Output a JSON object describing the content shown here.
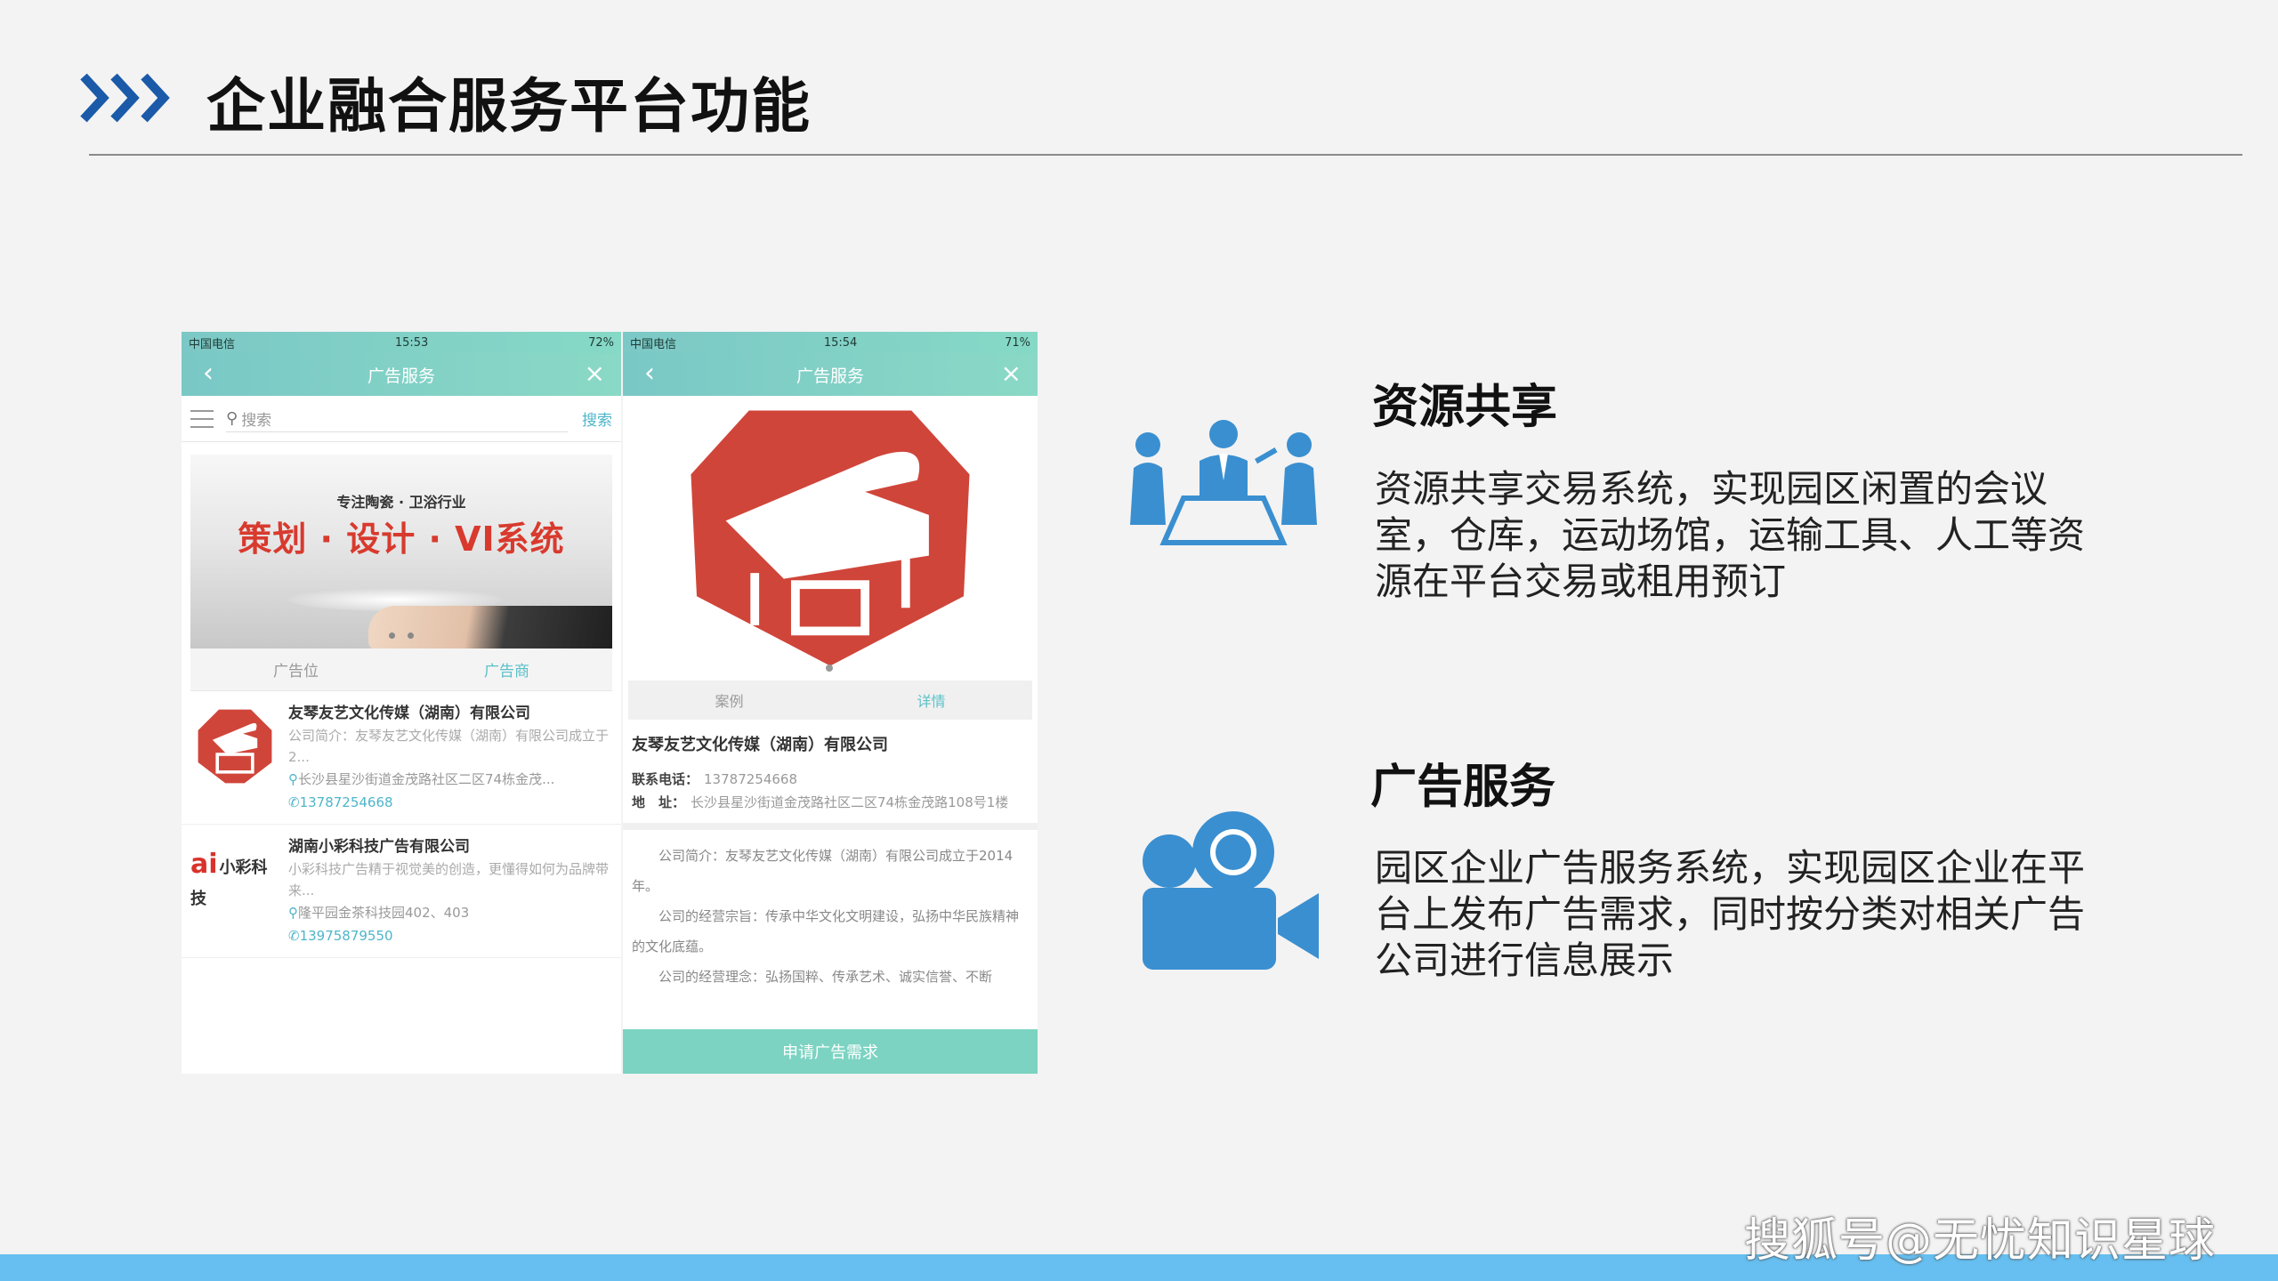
{
  "title": "企业融合服务平台功能",
  "watermark": "搜狐号@无忧知识星球",
  "colors": {
    "accent_blue": "#1a5aa8",
    "icon_blue": "#3a8fd0",
    "teal": "#7ccac6",
    "bottom_bar": "#66bff0"
  },
  "phone_left": {
    "status": {
      "carrier": "中国电信",
      "time": "15:53",
      "battery": "72%"
    },
    "nav_title": "广告服务",
    "search_placeholder": "搜索",
    "search_button": "搜索",
    "banner": {
      "subtitle": "专注陶瓷 · 卫浴行业",
      "headline": "策划 · 设计 · VI系统"
    },
    "tabs": [
      "广告位",
      "广告商"
    ],
    "companies": [
      {
        "name": "友琴友艺文化传媒（湖南）有限公司",
        "desc": "公司简介：友琴友艺文化传媒（湖南）有限公司成立于2...",
        "address": "长沙县星沙街道金茂路社区二区74栋金茂...",
        "phone": "13787254668"
      },
      {
        "name": "湖南小彩科技广告有限公司",
        "logo_text": "ai",
        "logo_sub": "小彩科技",
        "desc": "小彩科技广告精于视觉美的创造，更懂得如何为品牌带来...",
        "address": "隆平园金茶科技园402、403",
        "phone": "13975879550"
      }
    ]
  },
  "phone_right": {
    "status": {
      "carrier": "中国电信",
      "time": "15:54",
      "battery": "71%"
    },
    "nav_title": "广告服务",
    "tabs": [
      "案例",
      "详情"
    ],
    "company_name": "友琴友艺文化传媒（湖南）有限公司",
    "phone_label": "联系电话：",
    "phone": "13787254668",
    "address_label": "地　址：",
    "address": "长沙县星沙街道金茂路社区二区74栋金茂路108号1楼",
    "intro": [
      "公司简介：友琴友艺文化传媒（湖南）有限公司成立于2014年。",
      "公司的经营宗旨：传承中华文化文明建设，弘扬中华民族精神的文化底蕴。",
      "公司的经营理念：弘扬国粹、传承艺术、诚实信誉、不断"
    ],
    "apply_button": "申请广告需求"
  },
  "features": [
    {
      "title": "资源共享",
      "desc": "资源共享交易系统，实现园区闲置的会议室，仓库，运动场馆，运输工具、人工等资源在平台交易或租用预订",
      "icon": "meeting-icon"
    },
    {
      "title": "广告服务",
      "desc": "园区企业广告服务系统，实现园区企业在平台上发布广告需求，同时按分类对相关广告公司进行信息展示",
      "icon": "video-camera-icon"
    }
  ]
}
